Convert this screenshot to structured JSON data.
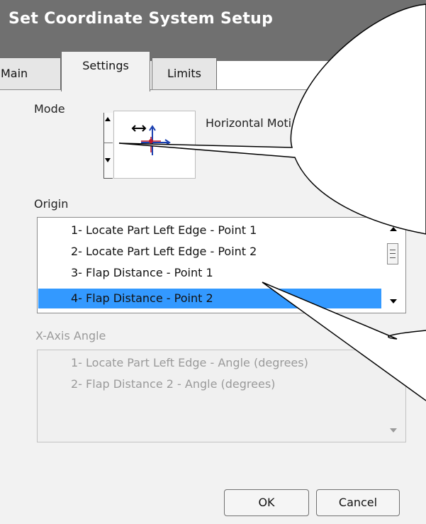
{
  "window": {
    "title": "Set Coordinate System Setup"
  },
  "tabs": [
    {
      "label": "Main"
    },
    {
      "label": "Settings"
    },
    {
      "label": "Limits"
    }
  ],
  "mode": {
    "label": "Mode",
    "value_text": "Horizontal Moti",
    "icon": "crosshair-axes-icon"
  },
  "origin": {
    "label": "Origin",
    "items": [
      "1- Locate Part Left Edge - Point 1",
      "2- Locate Part Left Edge - Point 2",
      "3- Flap Distance - Point 1",
      "4- Flap Distance - Point 2"
    ],
    "selected_index": 3
  },
  "x_axis_angle": {
    "label": "X-Axis Angle",
    "items": [
      "1- Locate Part Left Edge - Angle (degrees)",
      "2- Flap Distance 2 - Angle (degrees)"
    ]
  },
  "buttons": {
    "ok": "OK",
    "cancel": "Cancel"
  },
  "colors": {
    "title_bar": "#707070",
    "selection": "#3399ff",
    "panel": "#f2f2f2"
  }
}
